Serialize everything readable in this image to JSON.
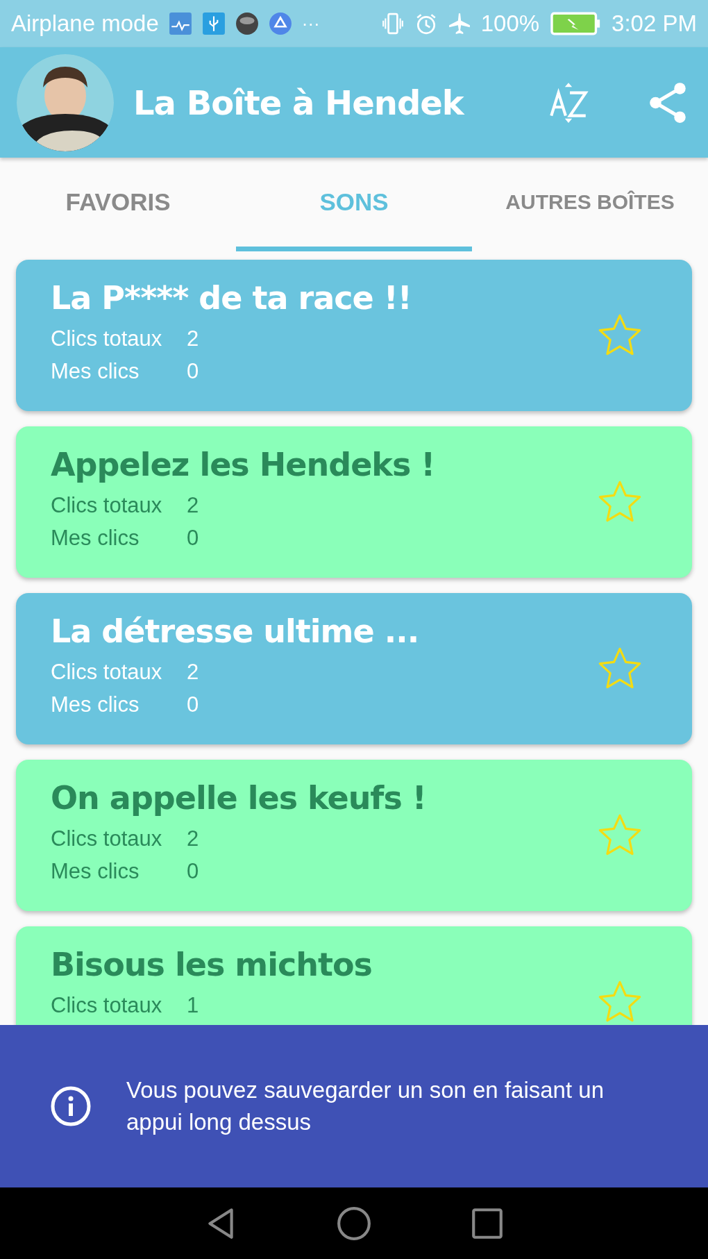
{
  "status_bar": {
    "left_text": "Airplane mode",
    "more": "···",
    "battery": "100%",
    "time": "3:02 PM"
  },
  "app_bar": {
    "title": "La Boîte à Hendek"
  },
  "tabs": [
    {
      "label": "FAVORIS",
      "selected": false
    },
    {
      "label": "SONS",
      "selected": true
    },
    {
      "label": "AUTRES BOÎTES",
      "selected": false
    }
  ],
  "sounds": [
    {
      "title": "La P**** de ta race !!",
      "color": "#6ac4de",
      "favorite": false,
      "stats": [
        {
          "label": "Clics totaux",
          "value": "2"
        },
        {
          "label": "Mes clics",
          "value": "0"
        }
      ]
    },
    {
      "title": "Appelez les Hendeks !",
      "color": "#8affb9",
      "favorite": false,
      "stats": [
        {
          "label": "Clics totaux",
          "value": "2"
        },
        {
          "label": "Mes clics",
          "value": "0"
        }
      ]
    },
    {
      "title": "La détresse ultime ...",
      "color": "#6ac4de",
      "favorite": false,
      "stats": [
        {
          "label": "Clics totaux",
          "value": "2"
        },
        {
          "label": "Mes clics",
          "value": "0"
        }
      ]
    },
    {
      "title": "On appelle les keufs !",
      "color": "#8affb9",
      "favorite": false,
      "stats": [
        {
          "label": "Clics totaux",
          "value": "2"
        },
        {
          "label": "Mes clics",
          "value": "0"
        }
      ]
    },
    {
      "title": "Bisous les michtos",
      "color": "#8affb9",
      "favorite": false,
      "stats": [
        {
          "label": "Clics totaux",
          "value": "1"
        }
      ]
    }
  ],
  "snackbar": {
    "message": "Vous pouvez sauvegarder un son en faisant un appui long dessus"
  }
}
